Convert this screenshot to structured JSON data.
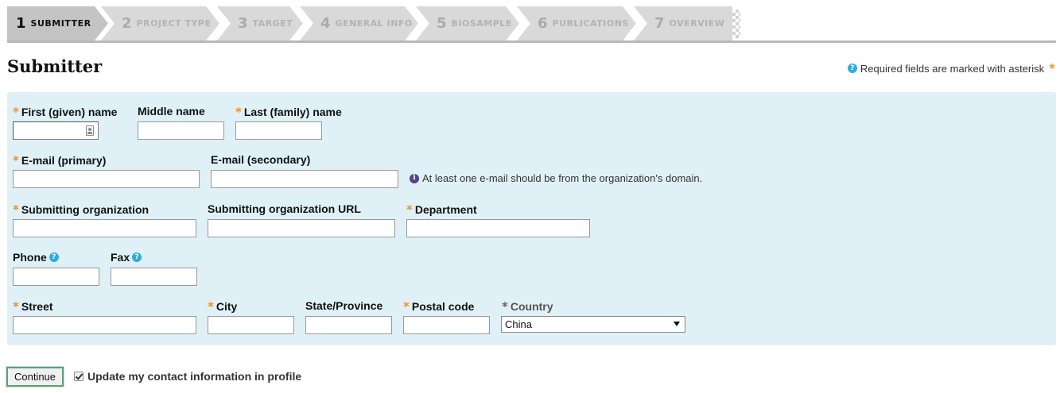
{
  "wizard": {
    "steps": [
      {
        "num": "1",
        "label": "SUBMITTER",
        "state": "active"
      },
      {
        "num": "2",
        "label": "PROJECT TYPE",
        "state": "todo"
      },
      {
        "num": "3",
        "label": "TARGET",
        "state": "todo"
      },
      {
        "num": "4",
        "label": "GENERAL INFO",
        "state": "todo"
      },
      {
        "num": "5",
        "label": "BIOSAMPLE",
        "state": "todo"
      },
      {
        "num": "6",
        "label": "PUBLICATIONS",
        "state": "todo"
      },
      {
        "num": "7",
        "label": "OVERVIEW",
        "state": "todo"
      }
    ]
  },
  "header": {
    "title": "Submitter",
    "required_note": "Required fields are marked with asterisk",
    "asterisk": "*"
  },
  "form": {
    "first_name": {
      "label": "First (given) name",
      "value": ""
    },
    "middle_name": {
      "label": "Middle name",
      "value": ""
    },
    "last_name": {
      "label": "Last (family) name",
      "value": ""
    },
    "email_primary": {
      "label": "E-mail (primary)",
      "value": ""
    },
    "email_secondary": {
      "label": "E-mail (secondary)",
      "value": ""
    },
    "email_hint": "At least one e-mail should be from the organization's domain.",
    "organization": {
      "label": "Submitting organization",
      "value": ""
    },
    "organization_url": {
      "label": "Submitting organization URL",
      "value": ""
    },
    "department": {
      "label": "Department",
      "value": ""
    },
    "phone": {
      "label": "Phone",
      "value": ""
    },
    "fax": {
      "label": "Fax",
      "value": ""
    },
    "street": {
      "label": "Street",
      "value": ""
    },
    "city": {
      "label": "City",
      "value": ""
    },
    "state": {
      "label": "State/Province",
      "value": ""
    },
    "postal_code": {
      "label": "Postal code",
      "value": ""
    },
    "country": {
      "label": "Country",
      "selected": "China"
    }
  },
  "footer": {
    "continue_label": "Continue",
    "update_label": "Update my contact information in profile",
    "update_checked": true
  },
  "icons": {
    "help": "?",
    "info": "i"
  },
  "colors": {
    "accent_orange": "#f2901f",
    "panel_bg": "#e0f0f7",
    "help_blue": "#2eaee0",
    "info_purple": "#5a3d8c",
    "step_active": "#c4c4c4",
    "step_inactive": "#d9d9d9",
    "button_border": "#5ba07a"
  }
}
